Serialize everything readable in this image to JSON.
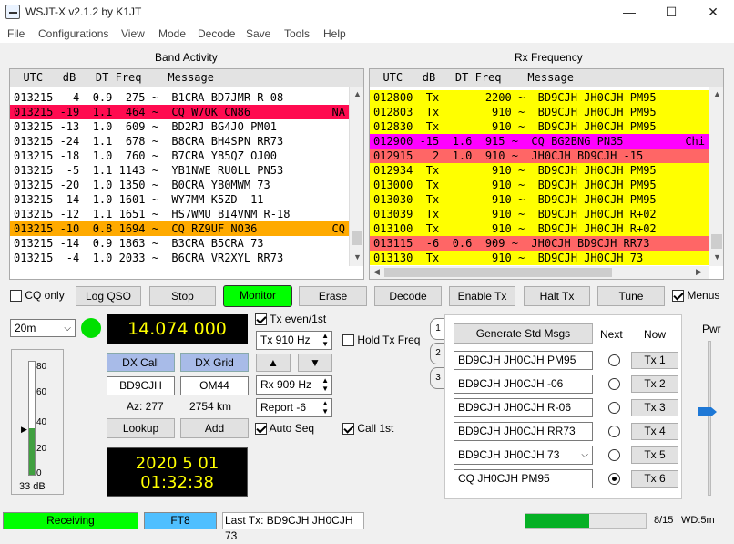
{
  "window": {
    "title": "WSJT-X   v2.1.2   by K1JT",
    "minimize": "—",
    "maximize": "☐",
    "close": "✕"
  },
  "menu": [
    "File",
    "Configurations",
    "View",
    "Mode",
    "Decode",
    "Save",
    "Tools",
    "Help"
  ],
  "band_activity": {
    "title": "Band Activity",
    "header": "  UTC   dB   DT Freq    Message",
    "rows": [
      {
        "text": "013215  -4  0.9  275 ~  B1CRA BD7JMR R-08",
        "tail": "",
        "bg": "#ffffff"
      },
      {
        "text": "013215 -19  1.1  464 ~  CQ W7OK CN86",
        "tail": "NA",
        "bg": "#ff0b50"
      },
      {
        "text": "013215 -13  1.0  609 ~  BD2RJ BG4JO PM01",
        "tail": "",
        "bg": "#ffffff"
      },
      {
        "text": "013215 -24  1.1  678 ~  B8CRA BH4SPN RR73",
        "tail": "",
        "bg": "#ffffff"
      },
      {
        "text": "013215 -18  1.0  760 ~  B7CRA YB5QZ OJ00",
        "tail": "",
        "bg": "#ffffff"
      },
      {
        "text": "013215  -5  1.1 1143 ~  YB1NWE RU0LL PN53",
        "tail": "",
        "bg": "#ffffff"
      },
      {
        "text": "013215 -20  1.0 1350 ~  B0CRA YB0MWM 73",
        "tail": "",
        "bg": "#ffffff"
      },
      {
        "text": "013215 -14  1.0 1601 ~  WY7MM K5ZD -11",
        "tail": "",
        "bg": "#ffffff"
      },
      {
        "text": "013215 -12  1.1 1651 ~  HS7WMU BI4VNM R-18",
        "tail": "",
        "bg": "#ffffff"
      },
      {
        "text": "013215 -10  0.8 1694 ~  CQ RZ9UF NO36",
        "tail": "CQ",
        "bg": "#ffaa00"
      },
      {
        "text": "013215 -14  0.9 1863 ~  B3CRA B5CRA 73",
        "tail": "",
        "bg": "#ffffff"
      },
      {
        "text": "013215  -4  1.0 2033 ~  B6CRA VR2XYL RR73",
        "tail": "",
        "bg": "#ffffff"
      }
    ]
  },
  "rx_frequency": {
    "title": "Rx Frequency",
    "header": "  UTC   dB   DT Freq    Message",
    "rows": [
      {
        "text": "012800  Tx       2200 ~  BD9CJH JH0CJH PM95",
        "tail": "",
        "bg": "#ffff00"
      },
      {
        "text": "012803  Tx        910 ~  BD9CJH JH0CJH PM95",
        "tail": "",
        "bg": "#ffff00"
      },
      {
        "text": "012830  Tx        910 ~  BD9CJH JH0CJH PM95",
        "tail": "",
        "bg": "#ffff00"
      },
      {
        "text": "012900 -15  1.6  915 ~  CQ BG2BNG PN35",
        "tail": "Chi",
        "bg": "#ff00ff"
      },
      {
        "text": "012915   2  1.0  910 ~  JH0CJH BD9CJH -15",
        "tail": "",
        "bg": "#ff6666"
      },
      {
        "text": "012934  Tx        910 ~  BD9CJH JH0CJH PM95",
        "tail": "",
        "bg": "#ffff00"
      },
      {
        "text": "013000  Tx        910 ~  BD9CJH JH0CJH PM95",
        "tail": "",
        "bg": "#ffff00"
      },
      {
        "text": "013030  Tx        910 ~  BD9CJH JH0CJH PM95",
        "tail": "",
        "bg": "#ffff00"
      },
      {
        "text": "013039  Tx        910 ~  BD9CJH JH0CJH R+02",
        "tail": "",
        "bg": "#ffff00"
      },
      {
        "text": "013100  Tx        910 ~  BD9CJH JH0CJH R+02",
        "tail": "",
        "bg": "#ffff00"
      },
      {
        "text": "013115  -6  0.6  909 ~  JH0CJH BD9CJH RR73",
        "tail": "",
        "bg": "#ff6666"
      },
      {
        "text": "013130  Tx        910 ~  BD9CJH JH0CJH 73",
        "tail": "",
        "bg": "#ffff00"
      }
    ]
  },
  "controls": {
    "cq_only": "CQ only",
    "log_qso": "Log QSO",
    "stop": "Stop",
    "monitor": "Monitor",
    "erase": "Erase",
    "decode": "Decode",
    "enable_tx": "Enable Tx",
    "halt_tx": "Halt Tx",
    "tune": "Tune",
    "menus": "Menus"
  },
  "band": "20m",
  "dial_freq": "14.074 000",
  "tx_even": "Tx even/1st",
  "tx_freq": "Tx  910  Hz",
  "hold_tx_freq": "Hold Tx Freq",
  "rx_freq": "Rx  909  Hz",
  "report": "Report -6",
  "auto_seq": "Auto Seq",
  "call_1st": "Call 1st",
  "dx": {
    "call_btn": "DX Call",
    "grid_btn": "DX Grid",
    "call": "BD9CJH",
    "grid": "OM44",
    "az": "Az: 277",
    "dist": "2754 km",
    "lookup": "Lookup",
    "add": "Add"
  },
  "clock": {
    "date": "2020 5 01",
    "time": "01:32:38"
  },
  "meter": {
    "ticks": [
      "80",
      "60",
      "40",
      "20",
      "0"
    ],
    "db": "33 dB",
    "level": 33
  },
  "tx_msgs": {
    "generate": "Generate Std Msgs",
    "next": "Next",
    "now": "Now",
    "tabs": [
      "1",
      "2",
      "3"
    ],
    "messages": [
      "BD9CJH JH0CJH PM95",
      "BD9CJH JH0CJH -06",
      "BD9CJH JH0CJH R-06",
      "BD9CJH JH0CJH RR73",
      "BD9CJH JH0CJH 73",
      "CQ JH0CJH PM95"
    ],
    "buttons": [
      "Tx 1",
      "Tx 2",
      "Tx 3",
      "Tx 4",
      "Tx 5",
      "Tx 6"
    ],
    "selected": 5
  },
  "pwr": "Pwr",
  "status": {
    "receiving": "Receiving",
    "mode": "FT8",
    "last_tx": "Last Tx: BD9CJH JH0CJH 73",
    "count": "8/15",
    "wd": "WD:5m",
    "progress": 0.53
  },
  "colors": {
    "monitor": "#00ff00",
    "accent_blue": "#1e78d6",
    "lcd_text": "#ffff00"
  }
}
